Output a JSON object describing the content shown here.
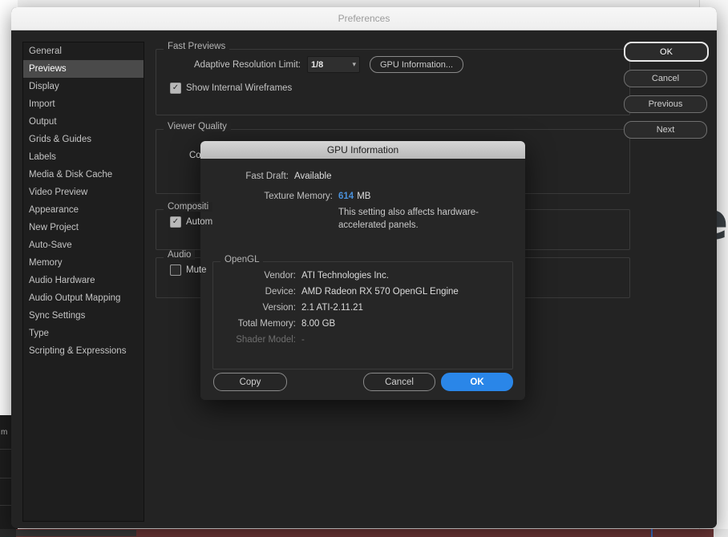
{
  "background": {
    "left_label": "m",
    "right_glyph": "e"
  },
  "prefs": {
    "title": "Preferences",
    "sidebar": {
      "items": [
        {
          "label": "General",
          "selected": false
        },
        {
          "label": "Previews",
          "selected": true
        },
        {
          "label": "Display",
          "selected": false
        },
        {
          "label": "Import",
          "selected": false
        },
        {
          "label": "Output",
          "selected": false
        },
        {
          "label": "Grids & Guides",
          "selected": false
        },
        {
          "label": "Labels",
          "selected": false
        },
        {
          "label": "Media & Disk Cache",
          "selected": false
        },
        {
          "label": "Video Preview",
          "selected": false
        },
        {
          "label": "Appearance",
          "selected": false
        },
        {
          "label": "New Project",
          "selected": false
        },
        {
          "label": "Auto-Save",
          "selected": false
        },
        {
          "label": "Memory",
          "selected": false
        },
        {
          "label": "Audio Hardware",
          "selected": false
        },
        {
          "label": "Audio Output Mapping",
          "selected": false
        },
        {
          "label": "Sync Settings",
          "selected": false
        },
        {
          "label": "Type",
          "selected": false
        },
        {
          "label": "Scripting & Expressions",
          "selected": false
        }
      ]
    },
    "actions": {
      "ok": "OK",
      "cancel": "Cancel",
      "previous": "Previous",
      "next": "Next"
    },
    "fast_previews": {
      "legend": "Fast Previews",
      "adaptive_label": "Adaptive Resolution Limit:",
      "adaptive_value": "1/8",
      "gpu_info_button": "GPU Information...",
      "wireframes_label": "Show Internal Wireframes",
      "wireframes_checked": "✓"
    },
    "viewer_quality": {
      "legend": "Viewer Quality",
      "color_label": "Col"
    },
    "composition": {
      "legend": "Compositi",
      "auto_label": "Autom",
      "auto_checked": "✓"
    },
    "audio": {
      "legend": "Audio",
      "mute_label": "Mute ",
      "mute_checked": ""
    }
  },
  "gpu_modal": {
    "title": "GPU Information",
    "fast_draft": {
      "key": "Fast Draft:",
      "value": "Available"
    },
    "texture_memory": {
      "key": "Texture Memory:",
      "value": "614",
      "unit": "MB"
    },
    "texture_note": "This setting also affects hardware-accelerated panels.",
    "opengl": {
      "legend": "OpenGL",
      "rows": [
        {
          "key": "Vendor:",
          "value": "ATI Technologies Inc.",
          "dim": false
        },
        {
          "key": "Device:",
          "value": "AMD Radeon RX 570 OpenGL Engine",
          "dim": false
        },
        {
          "key": "Version:",
          "value": "2.1 ATI-2.11.21",
          "dim": false
        },
        {
          "key": "Total Memory:",
          "value": "8.00 GB",
          "dim": false
        },
        {
          "key": "Shader Model:",
          "value": "-",
          "dim": true
        }
      ]
    },
    "buttons": {
      "copy": "Copy",
      "cancel": "Cancel",
      "ok": "OK"
    }
  },
  "colors": {
    "accent_blue": "#2a86e8",
    "value_blue": "#4a90d9",
    "window_bg": "#232323",
    "modal_bg": "#262626",
    "selected_row": "#4a4a4a"
  }
}
